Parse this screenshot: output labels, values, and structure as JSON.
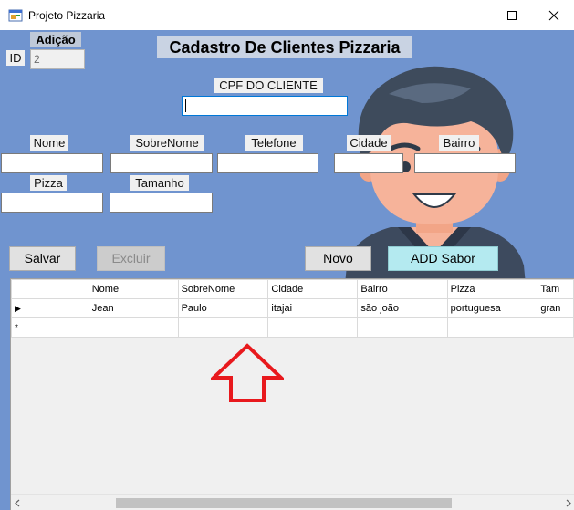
{
  "window": {
    "title": "Projeto Pizzaria",
    "icons": {
      "app": "pizzaria-app-icon",
      "minimize": "minimize-icon",
      "maximize": "maximize-icon",
      "close": "close-icon"
    }
  },
  "form": {
    "heading": "Cadastro De Clientes Pizzaria",
    "mode_label": "Adição",
    "id_label": "ID",
    "id_value": "2",
    "cpf_label": "CPF DO CLIENTE",
    "cpf_value": "",
    "fields": {
      "nome": {
        "label": "Nome",
        "value": ""
      },
      "sobrenome": {
        "label": "SobreNome",
        "value": ""
      },
      "telefone": {
        "label": "Telefone",
        "value": ""
      },
      "cidade": {
        "label": "Cidade",
        "value": ""
      },
      "bairro": {
        "label": "Bairro",
        "value": ""
      },
      "pizza": {
        "label": "Pizza",
        "value": ""
      },
      "tamanho": {
        "label": "Tamanho",
        "value": ""
      }
    }
  },
  "buttons": {
    "salvar": "Salvar",
    "excluir": "Excluir",
    "novo": "Novo",
    "add_sabor": "ADD Sabor"
  },
  "grid": {
    "columns": [
      "",
      "Nome",
      "SobreNome",
      "Cidade",
      "Bairro",
      "Pizza",
      "Tam"
    ],
    "rows": [
      {
        "indicator": "▶",
        "cells": [
          "",
          "Jean",
          "Paulo",
          "itajai",
          "são joão",
          "portuguesa",
          "gran"
        ]
      },
      {
        "indicator": "*",
        "cells": [
          "",
          "",
          "",
          "",
          "",
          "",
          ""
        ]
      }
    ]
  },
  "colors": {
    "form_background": "#7094cf",
    "add_sabor_button": "#b4eaf0",
    "annotation_arrow": "#e8191d"
  }
}
